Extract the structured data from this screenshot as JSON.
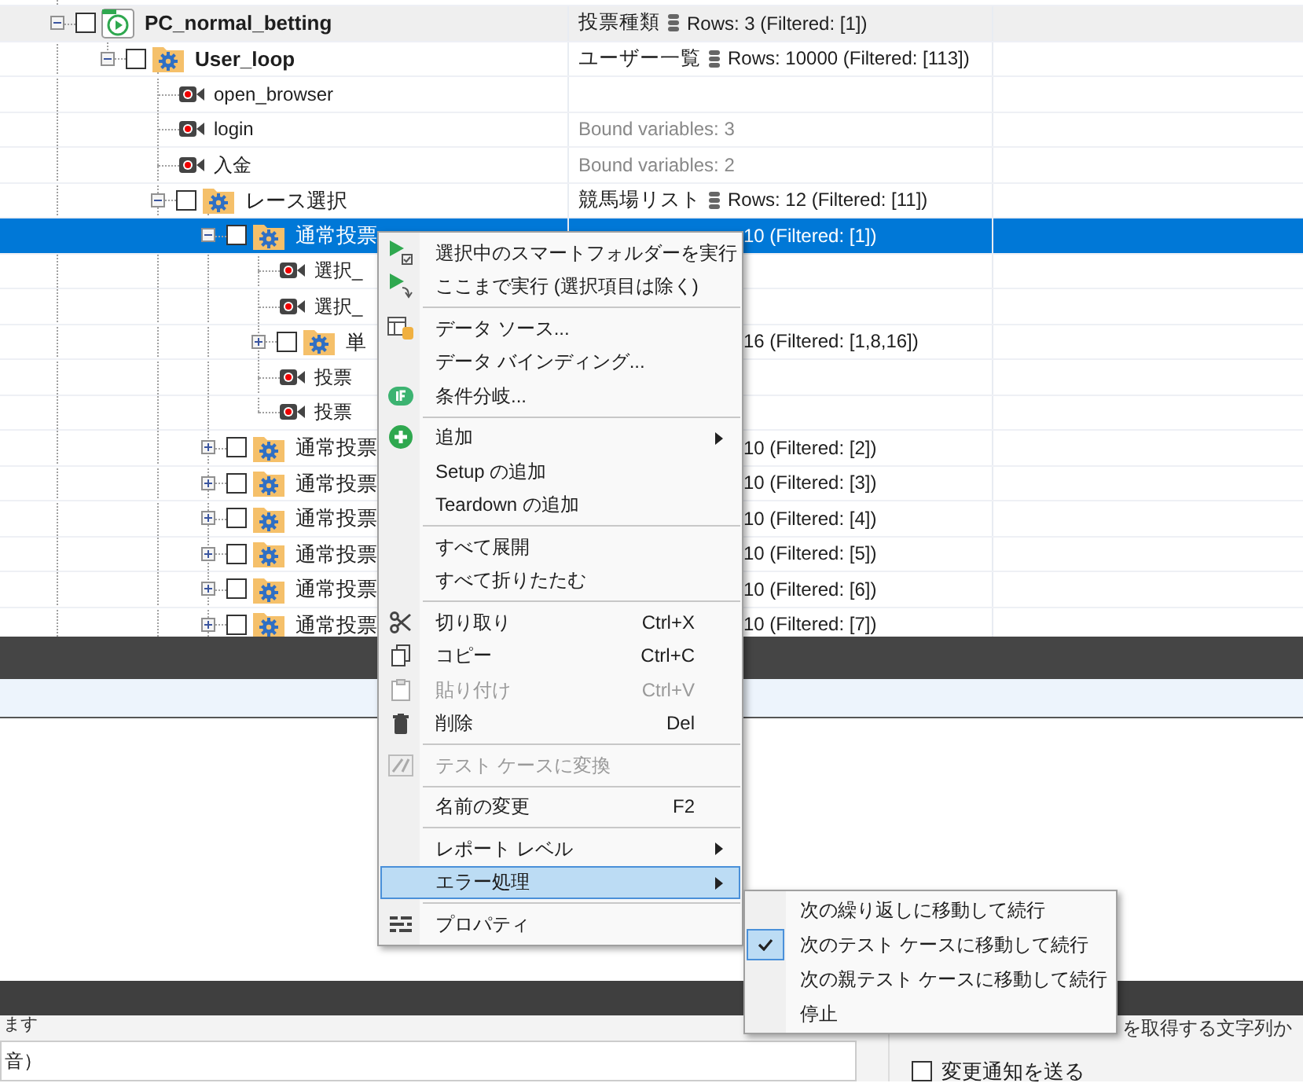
{
  "tree": {
    "nodes": [
      {
        "kind": "suite",
        "label": "PC_normal_betting",
        "bold": true,
        "expanded": true,
        "checked": false,
        "selected": false,
        "detail": {
          "kind": "data",
          "source": "投票種類",
          "rows": "Rows: 3 (Filtered: [1])"
        },
        "children": [
          {
            "kind": "folder",
            "label": "User_loop",
            "bold": true,
            "expanded": true,
            "checked": false,
            "selected": false,
            "detail": {
              "kind": "data",
              "source": "ユーザー一覧",
              "rows": "Rows: 10000 (Filtered: [113])"
            },
            "children": [
              {
                "kind": "recording",
                "label": "open_browser",
                "selected": false
              },
              {
                "kind": "recording",
                "label": "login",
                "selected": false,
                "detail": {
                  "kind": "bound",
                  "text": "Bound variables: 3"
                }
              },
              {
                "kind": "recording",
                "label": "入金",
                "selected": false,
                "detail": {
                  "kind": "bound",
                  "text": "Bound variables: 2"
                }
              },
              {
                "kind": "folder",
                "label": "レース選択",
                "bold": false,
                "expanded": true,
                "checked": false,
                "selected": false,
                "detail": {
                  "kind": "data",
                  "source": "競馬場リスト",
                  "rows": "Rows: 12 (Filtered: [11])"
                },
                "children": [
                  {
                    "kind": "folder",
                    "label": "通常投票",
                    "bold": false,
                    "expanded": true,
                    "checked": false,
                    "selected": true,
                    "detail": {
                      "kind": "partial",
                      "rows": "10 (Filtered: [1])"
                    },
                    "children": [
                      {
                        "kind": "recording",
                        "label": "選択_",
                        "selected": false
                      },
                      {
                        "kind": "recording",
                        "label": "選択_",
                        "selected": false
                      },
                      {
                        "kind": "folder",
                        "label": "単",
                        "bold": false,
                        "expanded": false,
                        "checked": false,
                        "selected": false,
                        "detail": {
                          "kind": "partial",
                          "rows": "16 (Filtered: [1,8,16])"
                        }
                      },
                      {
                        "kind": "recording",
                        "label": "投票",
                        "selected": false
                      },
                      {
                        "kind": "recording",
                        "label": "投票",
                        "selected": false
                      }
                    ]
                  },
                  {
                    "kind": "folder",
                    "label": "通常投票",
                    "bold": false,
                    "expanded": false,
                    "checked": false,
                    "selected": false,
                    "detail": {
                      "kind": "partial",
                      "rows": "10 (Filtered: [2])"
                    }
                  },
                  {
                    "kind": "folder",
                    "label": "通常投票",
                    "bold": false,
                    "expanded": false,
                    "checked": false,
                    "selected": false,
                    "detail": {
                      "kind": "partial",
                      "rows": "10 (Filtered: [3])"
                    }
                  },
                  {
                    "kind": "folder",
                    "label": "通常投票",
                    "bold": false,
                    "expanded": false,
                    "checked": false,
                    "selected": false,
                    "detail": {
                      "kind": "partial",
                      "rows": "10 (Filtered: [4])"
                    }
                  },
                  {
                    "kind": "folder",
                    "label": "通常投票",
                    "bold": false,
                    "expanded": false,
                    "checked": false,
                    "selected": false,
                    "detail": {
                      "kind": "partial",
                      "rows": "10 (Filtered: [5])"
                    }
                  },
                  {
                    "kind": "folder",
                    "label": "通常投票",
                    "bold": false,
                    "expanded": false,
                    "checked": false,
                    "selected": false,
                    "detail": {
                      "kind": "partial",
                      "rows": "10 (Filtered: [6])"
                    }
                  },
                  {
                    "kind": "folder",
                    "label": "通常投票",
                    "bold": false,
                    "expanded": false,
                    "checked": false,
                    "selected": false,
                    "detail": {
                      "kind": "partial",
                      "rows": "10 (Filtered: [7])"
                    }
                  }
                ]
              }
            ]
          }
        ]
      }
    ]
  },
  "context_menu": {
    "items": [
      {
        "kind": "item",
        "label": "選択中のスマートフォルダーを実行",
        "disabled": false,
        "submenu": false,
        "selected": false
      },
      {
        "kind": "item",
        "label": "ここまで実行 (選択項目は除く)",
        "disabled": false,
        "submenu": false,
        "selected": false
      },
      {
        "kind": "separator"
      },
      {
        "kind": "item",
        "label": "データ ソース...",
        "disabled": false,
        "submenu": false,
        "selected": false
      },
      {
        "kind": "item",
        "label": "データ バインディング...",
        "disabled": false,
        "submenu": false,
        "selected": false
      },
      {
        "kind": "item",
        "label": "条件分岐...",
        "disabled": false,
        "submenu": false,
        "selected": false
      },
      {
        "kind": "separator"
      },
      {
        "kind": "item",
        "label": "追加",
        "disabled": false,
        "submenu": true,
        "selected": false
      },
      {
        "kind": "item",
        "label": "Setup の追加",
        "disabled": false,
        "submenu": false,
        "selected": false
      },
      {
        "kind": "item",
        "label": "Teardown の追加",
        "disabled": false,
        "submenu": false,
        "selected": false
      },
      {
        "kind": "separator"
      },
      {
        "kind": "item",
        "label": "すべて展開",
        "disabled": false,
        "submenu": false,
        "selected": false
      },
      {
        "kind": "item",
        "label": "すべて折りたたむ",
        "disabled": false,
        "submenu": false,
        "selected": false
      },
      {
        "kind": "separator"
      },
      {
        "kind": "item",
        "label": "切り取り",
        "shortcut": "Ctrl+X",
        "disabled": false,
        "submenu": false,
        "selected": false
      },
      {
        "kind": "item",
        "label": "コピー",
        "shortcut": "Ctrl+C",
        "disabled": false,
        "submenu": false,
        "selected": false
      },
      {
        "kind": "item",
        "label": "貼り付け",
        "shortcut": "Ctrl+V",
        "disabled": true,
        "submenu": false,
        "selected": false
      },
      {
        "kind": "item",
        "label": "削除",
        "shortcut": "Del",
        "disabled": false,
        "submenu": false,
        "selected": false
      },
      {
        "kind": "separator"
      },
      {
        "kind": "item",
        "label": "テスト ケースに変換",
        "disabled": true,
        "submenu": false,
        "selected": false
      },
      {
        "kind": "separator"
      },
      {
        "kind": "item",
        "label": "名前の変更",
        "shortcut": "F2",
        "disabled": false,
        "submenu": false,
        "selected": false
      },
      {
        "kind": "separator"
      },
      {
        "kind": "item",
        "label": "レポート レベル",
        "disabled": false,
        "submenu": true,
        "selected": false
      },
      {
        "kind": "item",
        "label": "エラー処理",
        "disabled": false,
        "submenu": true,
        "selected": true
      },
      {
        "kind": "separator"
      },
      {
        "kind": "item",
        "label": "プロパティ",
        "disabled": false,
        "submenu": false,
        "selected": false
      }
    ]
  },
  "submenu": {
    "items": [
      {
        "label": "次の繰り返しに移動して続行",
        "checked": false
      },
      {
        "label": "次のテスト ケースに移動して続行",
        "checked": true
      },
      {
        "label": "次の親テスト ケースに移動して続行",
        "checked": false
      },
      {
        "label": "停止",
        "checked": false
      }
    ]
  },
  "bottom_panel": {
    "label": "ます",
    "field_value": "音）"
  },
  "side_panel": {
    "text": "を取得する文字列か",
    "notify": {
      "label": "変更通知を送る",
      "checked": false
    }
  }
}
